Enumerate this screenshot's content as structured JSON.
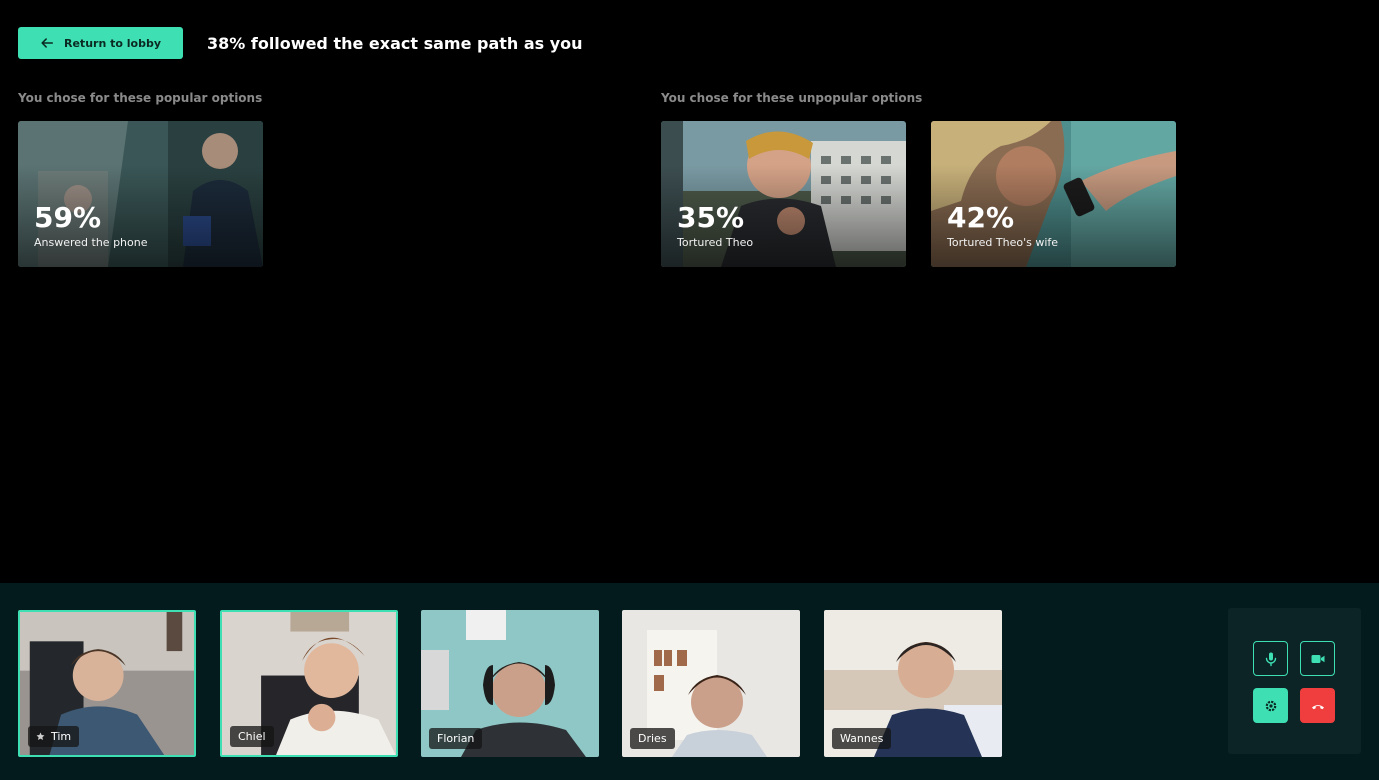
{
  "top": {
    "return_label": "Return to lobby",
    "headline": "38% followed the exact same path as you"
  },
  "popular": {
    "label": "You chose for these popular options",
    "cards": [
      {
        "percent": "59%",
        "caption": "Answered the phone"
      }
    ]
  },
  "unpopular": {
    "label": "You chose for these unpopular options",
    "cards": [
      {
        "percent": "35%",
        "caption": "Tortured Theo"
      },
      {
        "percent": "42%",
        "caption": "Tortured Theo's wife"
      }
    ]
  },
  "participants": [
    {
      "name": "Tim",
      "host": true
    },
    {
      "name": "Chiel"
    },
    {
      "name": "Florian"
    },
    {
      "name": "Dries"
    },
    {
      "name": "Wannes"
    }
  ],
  "controls": {
    "icons": [
      "microphone-icon",
      "camera-icon",
      "settings-icon",
      "hang-up-icon"
    ],
    "accent": "#3ee0b3",
    "danger": "#f03e3e"
  }
}
